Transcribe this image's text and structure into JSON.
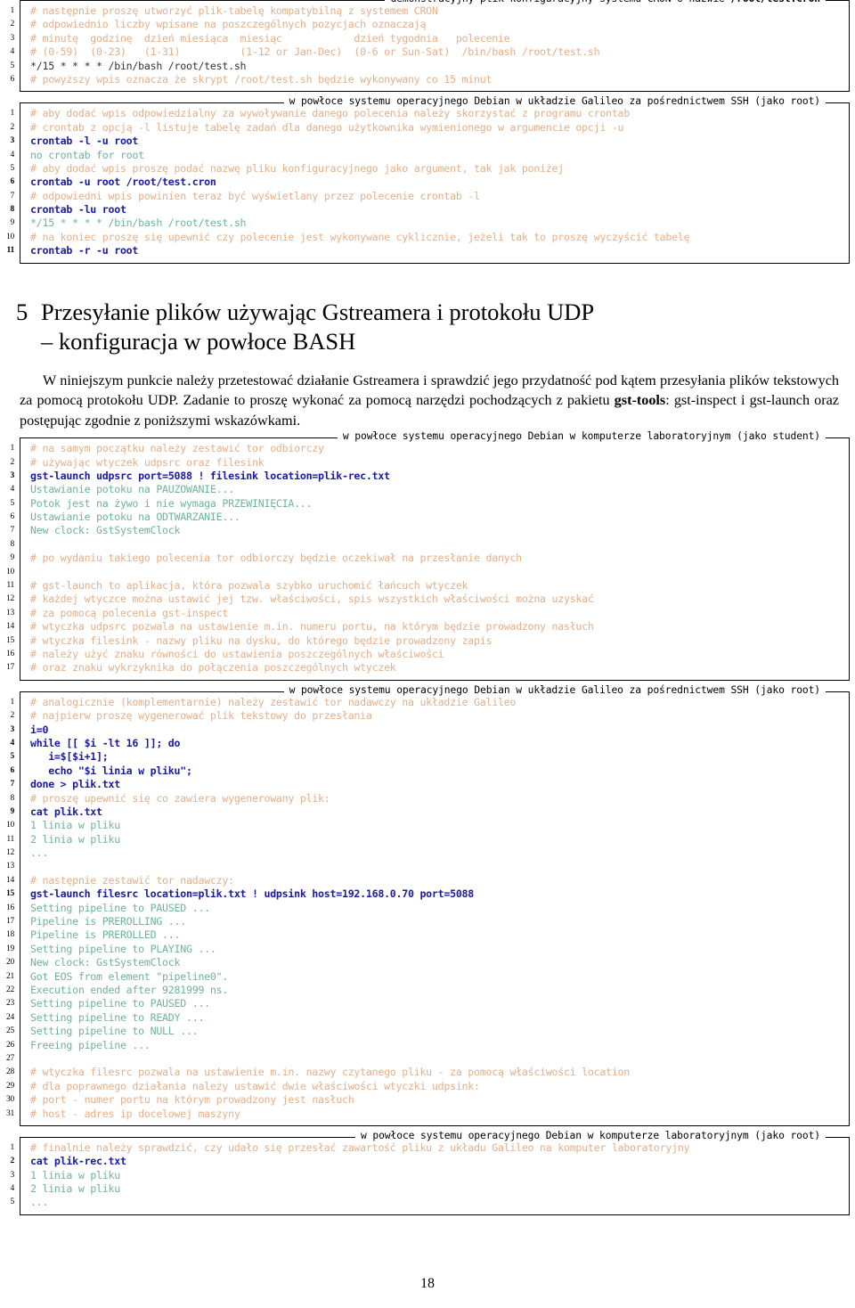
{
  "page": {
    "number": "18"
  },
  "blocks": [
    {
      "kind": "listing",
      "name": "listing-cron-file",
      "caption": "demonstracyjny plik konfiguracyjny systemu CRON o nazwie /root/test.cron",
      "caption_bold_tail": "/root/test.cron",
      "lines": [
        {
          "n": "1",
          "style": "comment",
          "text": "# następnie proszę utworzyć plik-tabelę kompatybilną z systemem CRON"
        },
        {
          "n": "2",
          "style": "comment",
          "text": "# odpowiednio liczby wpisane na poszczególnych pozycjach oznaczają"
        },
        {
          "n": "3",
          "style": "comment",
          "text": "# minutę  godzinę  dzień miesiąca  miesiąc            dzień tygodnia   polecenie"
        },
        {
          "n": "4",
          "style": "comment",
          "text": "# (0-59)  (0-23)   (1-31)          (1-12 or Jan-Dec)  (0-6 or Sun-Sat)  /bin/bash /root/test.sh"
        },
        {
          "n": "5",
          "style": "plain",
          "text": "*/15 * * * * /bin/bash /root/test.sh"
        },
        {
          "n": "6",
          "style": "comment",
          "text": "# powyższy wpis oznacza że skrypt /root/test.sh będzie wykonywany co 15 minut"
        }
      ]
    },
    {
      "kind": "listing",
      "name": "listing-crontab-galileo",
      "caption": "w powłoce systemu operacyjnego Debian w układzie Galileo za pośrednictwem SSH (jako root)",
      "lines": [
        {
          "n": "1",
          "style": "comment",
          "text": "# aby dodać wpis odpowiedzialny za wywoływanie danego polecenia należy skorzystać z programu crontab"
        },
        {
          "n": "2",
          "style": "comment",
          "text": "# crontab z opcją -l listuje tabelę zadań dla danego użytkownika wymienionego w argumencie opcji -u"
        },
        {
          "n": "3",
          "style": "cmd",
          "text": "crontab -l -u root"
        },
        {
          "n": "4",
          "style": "out",
          "text": "no crontab for root"
        },
        {
          "n": "5",
          "style": "comment",
          "text": "# aby dodać wpis proszę podać nazwę pliku konfiguracyjnego jako argument, tak jak poniżej"
        },
        {
          "n": "6",
          "style": "cmd",
          "text": "crontab -u root /root/test.cron"
        },
        {
          "n": "7",
          "style": "comment",
          "text": "# odpowiedni wpis powinien teraz być wyświetlany przez polecenie crontab -l"
        },
        {
          "n": "8",
          "style": "cmd",
          "text": "crontab -lu root"
        },
        {
          "n": "9",
          "style": "out",
          "text": "*/15 * * * * /bin/bash /root/test.sh"
        },
        {
          "n": "10",
          "style": "comment",
          "text": "# na koniec proszę się upewnić czy polecenie jest wykonywane cyklicznie, jeżeli tak to proszę wyczyścić tabelę"
        },
        {
          "n": "11",
          "style": "cmd",
          "text": "crontab -r -u root"
        }
      ]
    },
    {
      "kind": "heading",
      "name": "section-heading-5",
      "number": "5",
      "title_line1": "Przesyłanie plików używając Gstreamera i protokołu UDP",
      "title_line2": "– konfiguracja w powłoce BASH"
    },
    {
      "kind": "paragraph",
      "name": "intro-paragraph",
      "text_before_bold": "W niniejszym punkcie należy przetestować działanie Gstreamera i sprawdzić jego przydatność pod kątem przesyłania plików tekstowych za pomocą protokołu UDP. Zadanie to proszę wykonać za pomocą narzędzi pochodzących z pakietu ",
      "bold": "gst-tools",
      "text_after_bold": ": gst-inspect i gst-launch oraz postępując zgodnie z poniższymi wskazówkami."
    },
    {
      "kind": "listing",
      "name": "listing-receiver-student",
      "caption": "w powłoce systemu operacyjnego Debian w komputerze laboratoryjnym (jako student)",
      "lines": [
        {
          "n": "1",
          "style": "comment",
          "text": "# na samym początku należy zestawić tor odbiorczy"
        },
        {
          "n": "2",
          "style": "comment",
          "text": "# używając wtyczek udpsrc oraz filesink"
        },
        {
          "n": "3",
          "style": "cmd",
          "text": "gst-launch udpsrc port=5088 ! filesink location=plik-rec.txt"
        },
        {
          "n": "4",
          "style": "out",
          "text": "Ustawianie potoku na PAUZOWANIE..."
        },
        {
          "n": "5",
          "style": "out",
          "text": "Potok jest na żywo i nie wymaga PRZEWINIĘCIA..."
        },
        {
          "n": "6",
          "style": "out",
          "text": "Ustawianie potoku na ODTWARZANIE..."
        },
        {
          "n": "7",
          "style": "out",
          "text": "New clock: GstSystemClock"
        },
        {
          "n": "8",
          "style": "out",
          "text": ""
        },
        {
          "n": "9",
          "style": "comment",
          "text": "# po wydaniu takiego polecenia tor odbiorczy będzie oczekiwał na przesłanie danych"
        },
        {
          "n": "10",
          "style": "out",
          "text": ""
        },
        {
          "n": "11",
          "style": "comment",
          "text": "# gst-launch to aplikacja, która pozwala szybko uruchomić łańcuch wtyczek"
        },
        {
          "n": "12",
          "style": "comment",
          "text": "# każdej wtyczce można ustawić jej tzw. właściwości, spis wszystkich właściwości można uzyskać"
        },
        {
          "n": "13",
          "style": "comment",
          "text": "# za pomocą polecenia gst-inspect"
        },
        {
          "n": "14",
          "style": "comment",
          "text": "# wtyczka udpsrc pozwala na ustawienie m.in. numeru portu, na którym będzie prowadzony nasłuch"
        },
        {
          "n": "15",
          "style": "comment",
          "text": "# wtyczka filesink - nazwy pliku na dysku, do którego będzie prowadzony zapis"
        },
        {
          "n": "16",
          "style": "comment",
          "text": "# należy użyć znaku równości do ustawienia poszczególnych właściwości"
        },
        {
          "n": "17",
          "style": "comment",
          "text": "# oraz znaku wykrzyknika do połączenia poszczególnych wtyczek"
        }
      ]
    },
    {
      "kind": "listing",
      "name": "listing-sender-galileo",
      "caption": "w powłoce systemu operacyjnego Debian w układzie Galileo za pośrednictwem SSH (jako root)",
      "lines": [
        {
          "n": "1",
          "style": "comment",
          "text": "# analogicznie (komplementarnie) należy zestawić tor nadawczy na układzie Galileo"
        },
        {
          "n": "2",
          "style": "comment",
          "text": "# najpierw proszę wygenerować plik tekstowy do przesłania"
        },
        {
          "n": "3",
          "style": "cmd",
          "text": "i=0"
        },
        {
          "n": "4",
          "style": "cmd",
          "text": "while [[ $i -lt 16 ]]; do"
        },
        {
          "n": "5",
          "style": "cmd",
          "text": "   i=$[$i+1];"
        },
        {
          "n": "6",
          "style": "cmd",
          "text": "   echo \"$i linia w pliku\";"
        },
        {
          "n": "7",
          "style": "cmd",
          "text": "done > plik.txt"
        },
        {
          "n": "8",
          "style": "comment",
          "text": "# proszę upewnić się co zawiera wygenerowany plik:"
        },
        {
          "n": "9",
          "style": "cmd",
          "text": "cat plik.txt"
        },
        {
          "n": "10",
          "style": "out",
          "text": "1 linia w pliku"
        },
        {
          "n": "11",
          "style": "out",
          "text": "2 linia w pliku"
        },
        {
          "n": "12",
          "style": "out",
          "text": "..."
        },
        {
          "n": "13",
          "style": "out",
          "text": ""
        },
        {
          "n": "14",
          "style": "comment",
          "text": "# następnie zestawić tor nadawczy:"
        },
        {
          "n": "15",
          "style": "cmd",
          "text": "gst-launch filesrc location=plik.txt ! udpsink host=192.168.0.70 port=5088"
        },
        {
          "n": "16",
          "style": "out",
          "text": "Setting pipeline to PAUSED ..."
        },
        {
          "n": "17",
          "style": "out",
          "text": "Pipeline is PREROLLING ..."
        },
        {
          "n": "18",
          "style": "out",
          "text": "Pipeline is PREROLLED ..."
        },
        {
          "n": "19",
          "style": "out",
          "text": "Setting pipeline to PLAYING ..."
        },
        {
          "n": "20",
          "style": "out",
          "text": "New clock: GstSystemClock"
        },
        {
          "n": "21",
          "style": "out",
          "text": "Got EOS from element \"pipeline0\"."
        },
        {
          "n": "22",
          "style": "out",
          "text": "Execution ended after 9281999 ns."
        },
        {
          "n": "23",
          "style": "out",
          "text": "Setting pipeline to PAUSED ..."
        },
        {
          "n": "24",
          "style": "out",
          "text": "Setting pipeline to READY ..."
        },
        {
          "n": "25",
          "style": "out",
          "text": "Setting pipeline to NULL ..."
        },
        {
          "n": "26",
          "style": "out",
          "text": "Freeing pipeline ..."
        },
        {
          "n": "27",
          "style": "out",
          "text": ""
        },
        {
          "n": "28",
          "style": "comment",
          "text": "# wtyczka filesrc pozwala na ustawienie m.in. nazwy czytanego pliku - za pomocą właściwości location"
        },
        {
          "n": "29",
          "style": "comment",
          "text": "# dla poprawnego działania należy ustawić dwie właściwości wtyczki udpsink:"
        },
        {
          "n": "30",
          "style": "comment",
          "text": "# port - numer portu na którym prowadzony jest nasłuch"
        },
        {
          "n": "31",
          "style": "comment",
          "text": "# host - adres ip docelowej maszyny"
        }
      ]
    },
    {
      "kind": "listing",
      "name": "listing-verify-lab",
      "caption": "w powłoce systemu operacyjnego Debian w komputerze laboratoryjnym (jako root)",
      "lines": [
        {
          "n": "1",
          "style": "comment",
          "text": "# finalnie należy sprawdzić, czy udało się przesłać zawartość pliku z układu Galileo na komputer laboratoryjny"
        },
        {
          "n": "2",
          "style": "cmd",
          "text": "cat plik-rec.txt"
        },
        {
          "n": "3",
          "style": "out",
          "text": "1 linia w pliku"
        },
        {
          "n": "4",
          "style": "out",
          "text": "2 linia w pliku"
        },
        {
          "n": "5",
          "style": "out",
          "text": "..."
        }
      ]
    }
  ],
  "colors": {
    "comment": "#e3b08a",
    "command": "#1a1a9e",
    "output": "#6fb39a",
    "frame": "#000000"
  }
}
